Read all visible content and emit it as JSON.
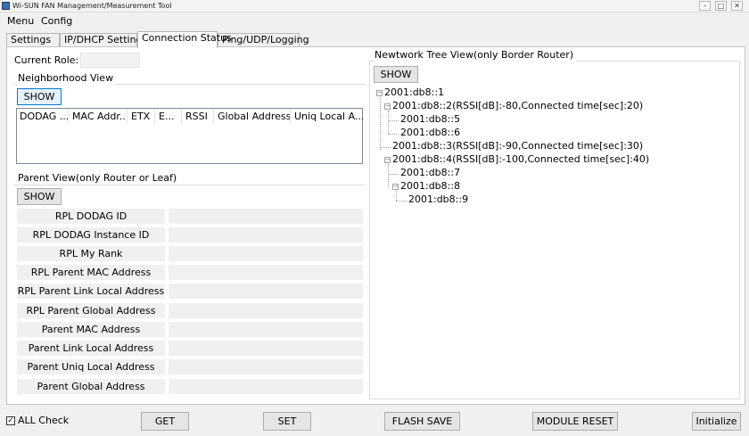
{
  "window": {
    "title": "Wi-SUN FAN Management/Measurement Tool"
  },
  "menu": [
    "Menu",
    "Config"
  ],
  "tabs": [
    "Settings",
    "IP/DHCP Settings",
    "Connection Status",
    "Ping/UDP/Logging"
  ],
  "active_tab": "Connection Status",
  "left": {
    "current_role_label": "Current Role:",
    "current_role_value": "",
    "neighborhood": {
      "title": "Neighborhood View",
      "show_label": "SHOW",
      "columns": [
        "DODAG ...",
        "MAC Addr...",
        "ETX",
        "E...",
        "RSSI",
        "Global Address",
        "Uniq Local A..."
      ]
    },
    "parent": {
      "title": "Parent View(only Router or Leaf)",
      "show_label": "SHOW",
      "rows": [
        {
          "label": "RPL DODAG ID",
          "value": ""
        },
        {
          "label": "RPL DODAG Instance ID",
          "value": ""
        },
        {
          "label": "RPL My Rank",
          "value": ""
        },
        {
          "label": "RPL Parent MAC Address",
          "value": ""
        },
        {
          "label": "RPL Parent Link Local Address",
          "value": ""
        },
        {
          "label": "RPL Parent Global Address",
          "value": ""
        },
        {
          "label": "Parent MAC Address",
          "value": ""
        },
        {
          "label": "Parent Link Local Address",
          "value": ""
        },
        {
          "label": "Parent Uniq Local Address",
          "value": ""
        },
        {
          "label": "Parent Global Address",
          "value": ""
        }
      ]
    }
  },
  "right": {
    "title": "Newtwork Tree View(only Border Router)",
    "show_label": "SHOW",
    "tree": [
      {
        "text": "2001:db8::1",
        "depth": 0
      },
      {
        "text": "2001:db8::2(RSSI[dB]:-80,Connected time[sec]:20)",
        "depth": 1
      },
      {
        "text": "2001:db8::5",
        "depth": 2
      },
      {
        "text": "2001:db8::6",
        "depth": 2
      },
      {
        "text": "2001:db8::3(RSSI[dB]:-90,Connected time[sec]:30)",
        "depth": 1
      },
      {
        "text": "2001:db8::4(RSSI[dB]:-100,Connected time[sec]:40)",
        "depth": 1
      },
      {
        "text": "2001:db8::7",
        "depth": 2
      },
      {
        "text": "2001:db8::8",
        "depth": 2
      },
      {
        "text": "2001:db8::9",
        "depth": 3
      }
    ]
  },
  "bottom": {
    "all_check_label": "ALL Check",
    "all_check_checked": true,
    "get_label": "GET",
    "set_label": "SET",
    "flash_save_label": "FLASH SAVE",
    "module_reset_label": "MODULE RESET",
    "initialize_label": "Initialize"
  },
  "colors": {
    "focus_button_bg": "#e5f1fb",
    "focus_button_border": "#0078d7",
    "window_bg": "#f0f0f0"
  }
}
